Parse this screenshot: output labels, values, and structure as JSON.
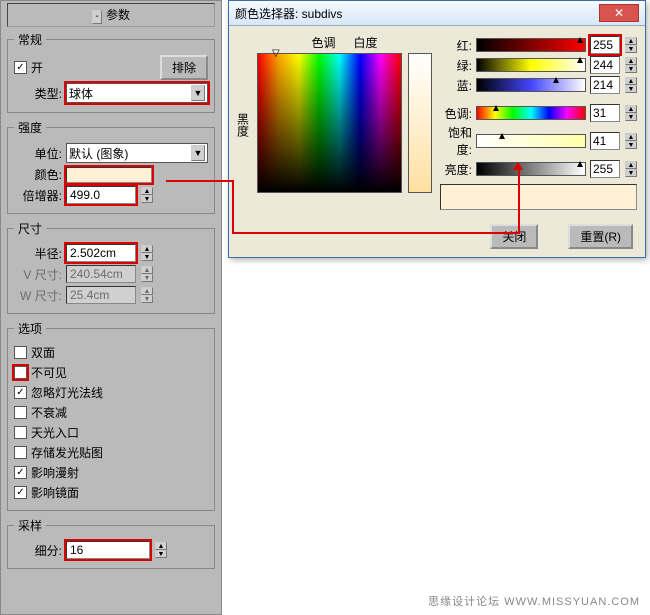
{
  "panel": {
    "title": "参数",
    "general": {
      "legend": "常规",
      "on_label": "开",
      "exclude_btn": "排除",
      "type_label": "类型:",
      "type_value": "球体"
    },
    "intensity": {
      "legend": "强度",
      "unit_label": "单位:",
      "unit_value": "默认 (图象)",
      "color_label": "颜色:",
      "multiplier_label": "倍增器:",
      "multiplier_value": "499.0"
    },
    "size": {
      "legend": "尺寸",
      "radius_label": "半径:",
      "radius_value": "2.502cm",
      "v_label": "V 尺寸:",
      "v_value": "240.54cm",
      "w_label": "W 尺寸:",
      "w_value": "25.4cm"
    },
    "options": {
      "legend": "选项",
      "o1": "双面",
      "o2": "不可见",
      "o3": "忽略灯光法线",
      "o4": "不衰减",
      "o5": "天光入口",
      "o6": "存储发光贴图",
      "o7": "影响漫射",
      "o8": "影响镜面"
    },
    "sampling": {
      "legend": "采样",
      "subdiv_label": "细分:",
      "subdiv_value": "16"
    }
  },
  "colorwin": {
    "title": "颜色选择器: subdivs",
    "hue": "色调",
    "whiteness": "白度",
    "blackness": "黑度",
    "red": "红:",
    "green": "绿:",
    "blue": "蓝:",
    "hue_l": "色调:",
    "sat": "饱和度:",
    "val": "亮度:",
    "r_val": "255",
    "g_val": "244",
    "b_val": "214",
    "h_val": "31",
    "s_val": "41",
    "v_val": "255",
    "close": "关闭",
    "reset": "重置(R)"
  },
  "watermark": "思缘设计论坛  WWW.MISSYUAN.COM"
}
